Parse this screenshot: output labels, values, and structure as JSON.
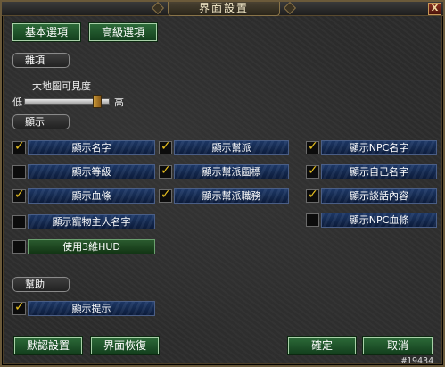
{
  "window": {
    "title": "界面設置",
    "close_glyph": "X"
  },
  "tabs": [
    {
      "label": "基本選項"
    },
    {
      "label": "高級選項"
    }
  ],
  "sections": {
    "misc": "雜項",
    "display": "顯示",
    "help": "幫助"
  },
  "slider": {
    "label": "大地圖可見度",
    "low": "低",
    "high": "高",
    "value": 0.9
  },
  "options": [
    {
      "label": "顯示名字",
      "checked": true
    },
    {
      "label": "顯示幫派",
      "checked": true
    },
    {
      "label": "顯示NPC名字",
      "checked": true
    },
    {
      "label": "顯示等級",
      "checked": false
    },
    {
      "label": "顯示幫派圖標",
      "checked": true
    },
    {
      "label": "顯示自己名字",
      "checked": true
    },
    {
      "label": "顯示血條",
      "checked": true
    },
    {
      "label": "顯示幫派職務",
      "checked": true
    },
    {
      "label": "顯示談話內容",
      "checked": true
    },
    {
      "label": "顯示寵物主人名字",
      "checked": false
    },
    {
      "label": "顯示NPC血條",
      "checked": false
    },
    {
      "label": "使用3維HUD",
      "checked": false
    },
    {
      "label": "顯示提示",
      "checked": true
    }
  ],
  "buttons": {
    "default": "默認設置",
    "restore": "界面恢復",
    "ok": "確定",
    "cancel": "取消"
  },
  "watermark": "#19434",
  "colors": {
    "check": "#e8c020",
    "tab_green": "#2c6a38",
    "label_blue": "#1e3a6a",
    "frame_gold": "#8a7448"
  }
}
